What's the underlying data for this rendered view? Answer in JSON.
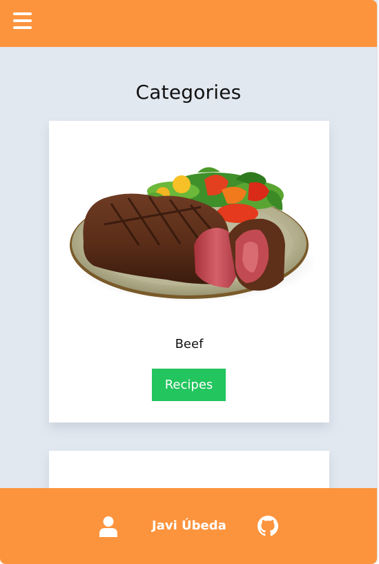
{
  "header": {
    "menu_icon": "hamburger-menu-icon",
    "background_color": "#fc943e"
  },
  "page": {
    "title": "Categories",
    "background_color": "#e2e8f0"
  },
  "categories": [
    {
      "name": "Beef",
      "image": "steak-plate-image",
      "button_label": "Recipes",
      "button_color": "#22c55e"
    }
  ],
  "footer": {
    "user_icon": "user-icon",
    "author_name": "Javi Úbeda",
    "github_icon": "github-icon",
    "background_color": "#fc943e"
  }
}
